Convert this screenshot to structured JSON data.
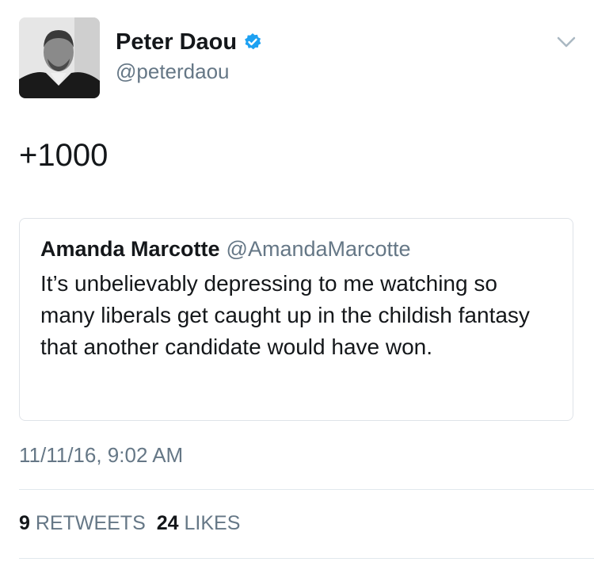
{
  "author": {
    "display_name": "Peter Daou",
    "handle": "@peterdaou",
    "verified": true,
    "avatar_icon": "profile-photo"
  },
  "tweet": {
    "text": "+1000"
  },
  "quoted_tweet": {
    "display_name": "Amanda Marcotte",
    "handle": "@AmandaMarcotte",
    "text": "It’s unbelievably depressing to me watching so many liberals get caught up in the childish fantasy that another candidate would have won."
  },
  "timestamp": "11/11/16, 9:02 AM",
  "stats": {
    "retweets_count": "9",
    "retweets_label": "RETWEETS",
    "likes_count": "24",
    "likes_label": "LIKES"
  },
  "colors": {
    "text": "#14171a",
    "secondary_text": "#657786",
    "verified_badge": "#1da1f2",
    "border": "#dfe3e8"
  }
}
